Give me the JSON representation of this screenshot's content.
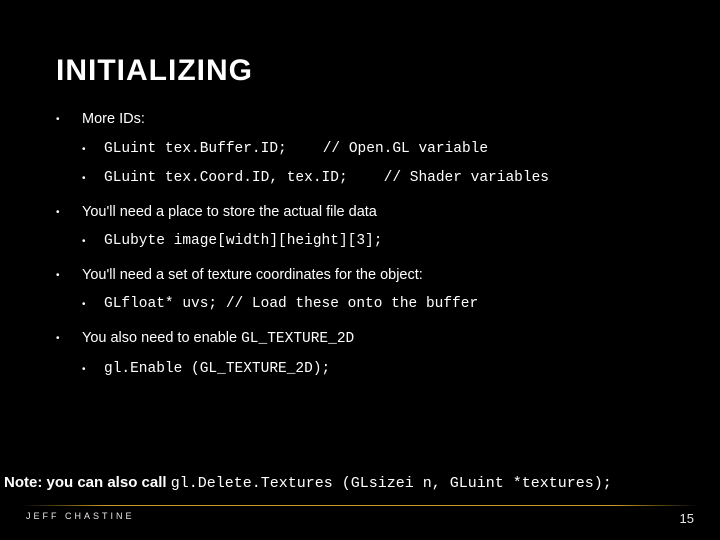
{
  "title": "INITIALIZING",
  "items": [
    {
      "text": "More IDs:",
      "sub": [
        {
          "code_left": "GLuint tex.Buffer.ID;",
          "code_right": "// Open.GL variable"
        },
        {
          "code_left": "GLuint tex.Coord.ID, tex.ID;",
          "code_right": "// Shader variables"
        }
      ]
    },
    {
      "text": "You'll need a place to store the actual file data",
      "sub": [
        {
          "code_left": "GLubyte image[width][height][3];",
          "code_right": ""
        }
      ]
    },
    {
      "text": "You'll need a set of texture coordinates for the object:",
      "sub": [
        {
          "code_left": "GLfloat* uvs;   // Load these onto the buffer",
          "code_right": ""
        }
      ]
    },
    {
      "text_prefix": "You also need to enable ",
      "text_code": "GL_TEXTURE_2D",
      "sub": [
        {
          "code_left": "gl.Enable (GL_TEXTURE_2D);",
          "code_right": ""
        }
      ]
    }
  ],
  "note": {
    "bold": "Note: you can also call ",
    "code": "gl.Delete.Textures (GLsizei n, GLuint *textures);"
  },
  "footer": {
    "author": "JEFF CHASTINE",
    "page": "15"
  }
}
